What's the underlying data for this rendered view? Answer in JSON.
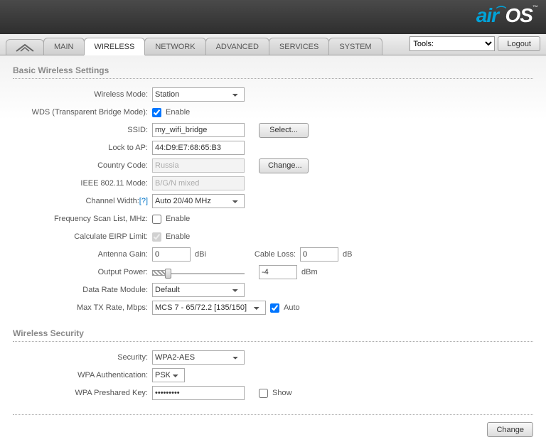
{
  "brand": {
    "air": "air",
    "os": "OS",
    "tm": "™"
  },
  "tabs": {
    "main": "MAIN",
    "wireless": "WIRELESS",
    "network": "NETWORK",
    "advanced": "ADVANCED",
    "services": "SERVICES",
    "system": "SYSTEM"
  },
  "toolbar": {
    "tools_label": "Tools:",
    "logout": "Logout"
  },
  "section_basic": "Basic Wireless Settings",
  "section_security": "Wireless Security",
  "labels": {
    "wireless_mode": "Wireless Mode:",
    "wds": "WDS (Transparent Bridge Mode):",
    "enable": "Enable",
    "ssid": "SSID:",
    "select_btn": "Select...",
    "lock_to_ap": "Lock to AP:",
    "country_code": "Country Code:",
    "change_btn": "Change...",
    "ieee_mode": "IEEE 802.11 Mode:",
    "channel_width": "Channel Width:",
    "help": "[?]",
    "freq_scan": "Frequency Scan List, MHz:",
    "calc_eirp": "Calculate EIRP Limit:",
    "antenna_gain": "Antenna Gain:",
    "dbi": "dBi",
    "cable_loss": "Cable Loss:",
    "db": "dB",
    "output_power": "Output Power:",
    "dbm": "dBm",
    "data_rate_module": "Data Rate Module:",
    "max_tx": "Max TX Rate, Mbps:",
    "auto": "Auto",
    "security": "Security:",
    "wpa_auth": "WPA Authentication:",
    "wpa_psk": "WPA Preshared Key:",
    "show": "Show"
  },
  "values": {
    "wireless_mode": "Station",
    "wds_enable": true,
    "ssid": "my_wifi_bridge",
    "lock_to_ap": "44:D9:E7:68:65:B3",
    "country_code": "Russia",
    "ieee_mode": "B/G/N mixed",
    "channel_width": "Auto 20/40 MHz",
    "freq_scan_enable": false,
    "calc_eirp_enable": true,
    "antenna_gain": "0",
    "cable_loss": "0",
    "output_power": "-4",
    "data_rate_module": "Default",
    "max_tx": "MCS 7 - 65/72.2 [135/150]",
    "max_tx_auto": true,
    "security": "WPA2-AES",
    "wpa_auth": "PSK",
    "wpa_psk": "•••••••••",
    "show_key": false
  },
  "footer": {
    "change": "Change"
  }
}
